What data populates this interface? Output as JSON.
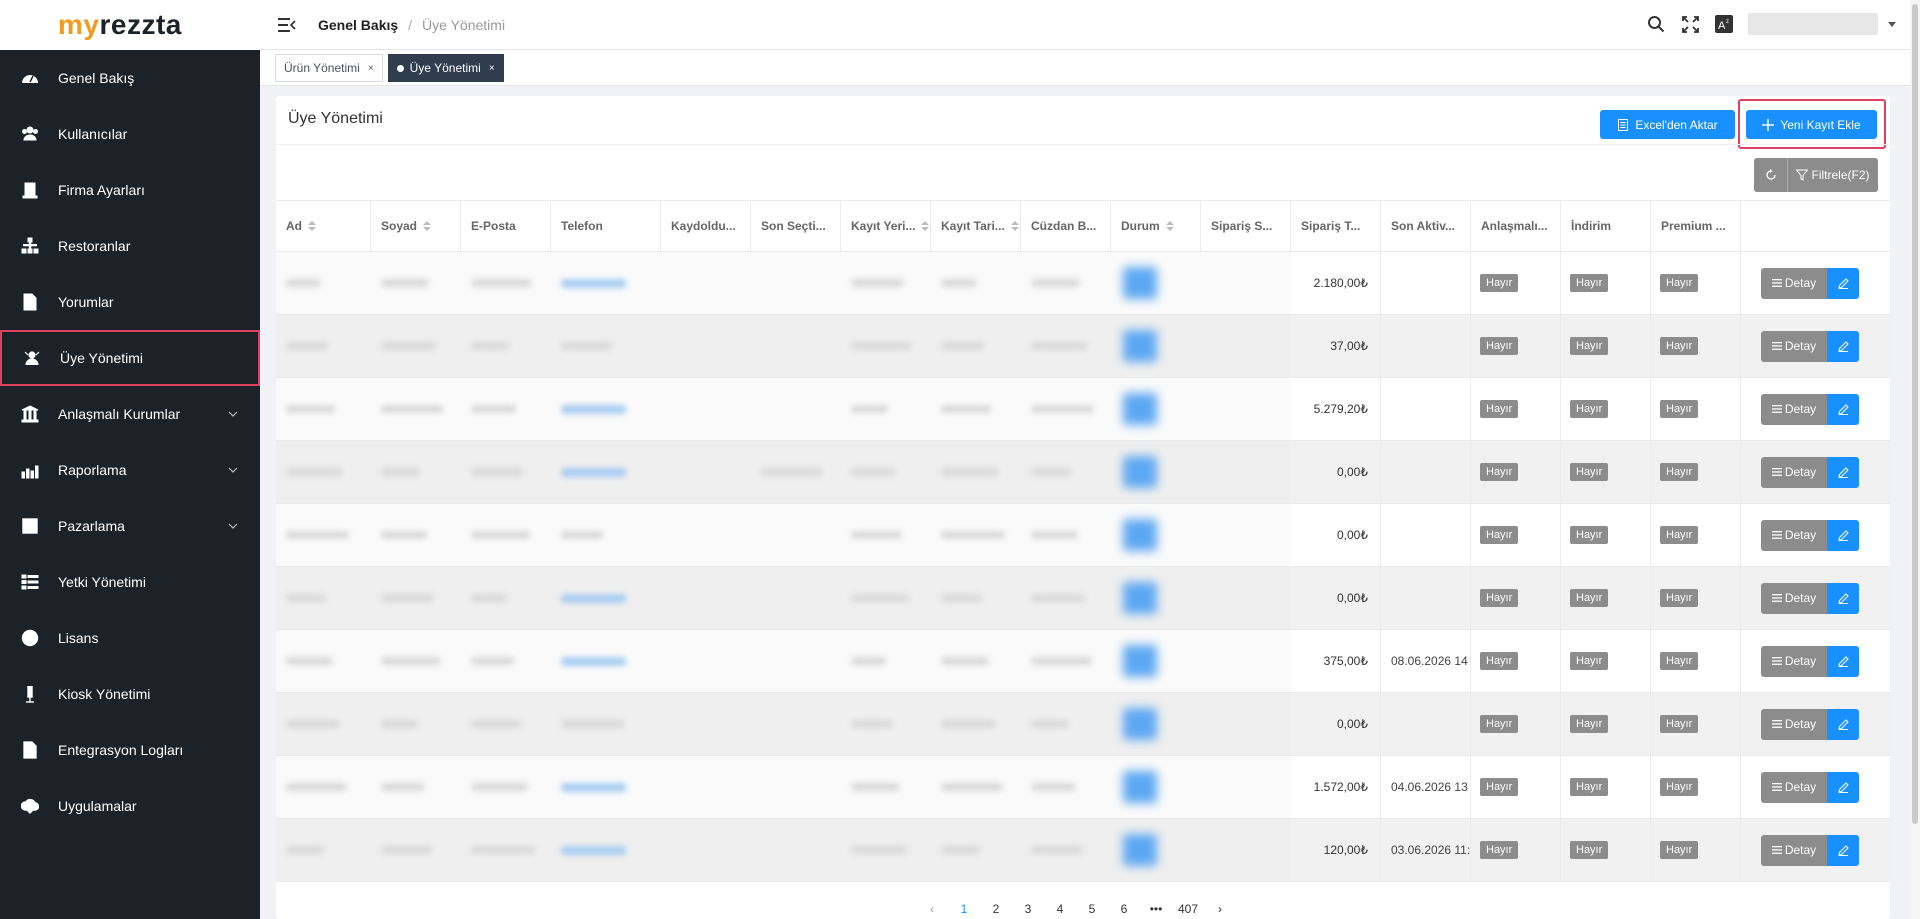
{
  "logo": {
    "part1": "my",
    "part2": "rezzta"
  },
  "sidebar": {
    "items": [
      {
        "label": "Genel Bakış",
        "icon": "dashboard-icon"
      },
      {
        "label": "Kullanıcılar",
        "icon": "users-icon"
      },
      {
        "label": "Firma Ayarları",
        "icon": "building-icon"
      },
      {
        "label": "Restoranlar",
        "icon": "sitemap-icon"
      },
      {
        "label": "Yorumlar",
        "icon": "document-icon"
      },
      {
        "label": "Üye Yönetimi",
        "icon": "members-icon",
        "active": true
      },
      {
        "label": "Anlaşmalı Kurumlar",
        "icon": "bank-icon",
        "expandable": true
      },
      {
        "label": "Raporlama",
        "icon": "chart-icon",
        "expandable": true
      },
      {
        "label": "Pazarlama",
        "icon": "grid-icon",
        "expandable": true
      },
      {
        "label": "Yetki Yönetimi",
        "icon": "list-icon"
      },
      {
        "label": "Lisans",
        "icon": "license-icon"
      },
      {
        "label": "Kiosk Yönetimi",
        "icon": "kiosk-icon"
      },
      {
        "label": "Entegrasyon Logları",
        "icon": "log-icon"
      },
      {
        "label": "Uygulamalar",
        "icon": "cloud-icon"
      }
    ]
  },
  "header": {
    "breadcrumb_1": "Genel Bakış",
    "breadcrumb_sep": "/",
    "breadcrumb_2": "Üye Yönetimi"
  },
  "tabs": [
    {
      "label": "Ürün Yönetimi",
      "close": "×"
    },
    {
      "label": "Üye Yönetimi",
      "close": "×",
      "active": true
    }
  ],
  "main": {
    "title": "Üye Yönetimi",
    "excel_button": "Excel'den Aktar",
    "new_button": "Yeni Kayıt Ekle",
    "filter_button": "Filtrele(F2)"
  },
  "table": {
    "columns": [
      "Ad",
      "Soyad",
      "E-Posta",
      "Telefon",
      "Kaydoldu...",
      "Son Seçti...",
      "Kayıt Yeri...",
      "Kayıt Tari...",
      "Cüzdan B...",
      "Durum",
      "Sipariş S...",
      "Sipariş T...",
      "Son Aktiv...",
      "Anlaşmalı...",
      "İndirim",
      "Premium ..."
    ],
    "rows": [
      {
        "order_total": "2.180,00₺",
        "last_activity": "",
        "agreement": "Hayır",
        "discount": "Hayır",
        "premium": "Hayır"
      },
      {
        "order_total": "37,00₺",
        "last_activity": "",
        "agreement": "Hayır",
        "discount": "Hayır",
        "premium": "Hayır"
      },
      {
        "order_total": "5.279,20₺",
        "last_activity": "",
        "agreement": "Hayır",
        "discount": "Hayır",
        "premium": "Hayır"
      },
      {
        "order_total": "0,00₺",
        "last_activity": "",
        "agreement": "Hayır",
        "discount": "Hayır",
        "premium": "Hayır"
      },
      {
        "order_total": "0,00₺",
        "last_activity": "",
        "agreement": "Hayır",
        "discount": "Hayır",
        "premium": "Hayır"
      },
      {
        "order_total": "0,00₺",
        "last_activity": "",
        "agreement": "Hayır",
        "discount": "Hayır",
        "premium": "Hayır"
      },
      {
        "order_total": "375,00₺",
        "last_activity": "08.06.2026 14",
        "agreement": "Hayır",
        "discount": "Hayır",
        "premium": "Hayır"
      },
      {
        "order_total": "0,00₺",
        "last_activity": "",
        "agreement": "Hayır",
        "discount": "Hayır",
        "premium": "Hayır"
      },
      {
        "order_total": "1.572,00₺",
        "last_activity": "04.06.2026 13",
        "agreement": "Hayır",
        "discount": "Hayır",
        "premium": "Hayır"
      },
      {
        "order_total": "120,00₺",
        "last_activity": "03.06.2026 11:",
        "agreement": "Hayır",
        "discount": "Hayır",
        "premium": "Hayır"
      }
    ],
    "detail_label": "Detay"
  },
  "pagination": {
    "prev": "‹",
    "pages": [
      "1",
      "2",
      "3",
      "4",
      "5",
      "6",
      "•••",
      "407"
    ],
    "next": "›",
    "current": "1"
  },
  "colors": {
    "sidebar_bg": "#1b2329",
    "accent": "#1890ff",
    "highlight": "#e0405f",
    "logo_orange": "#f29b1f"
  }
}
